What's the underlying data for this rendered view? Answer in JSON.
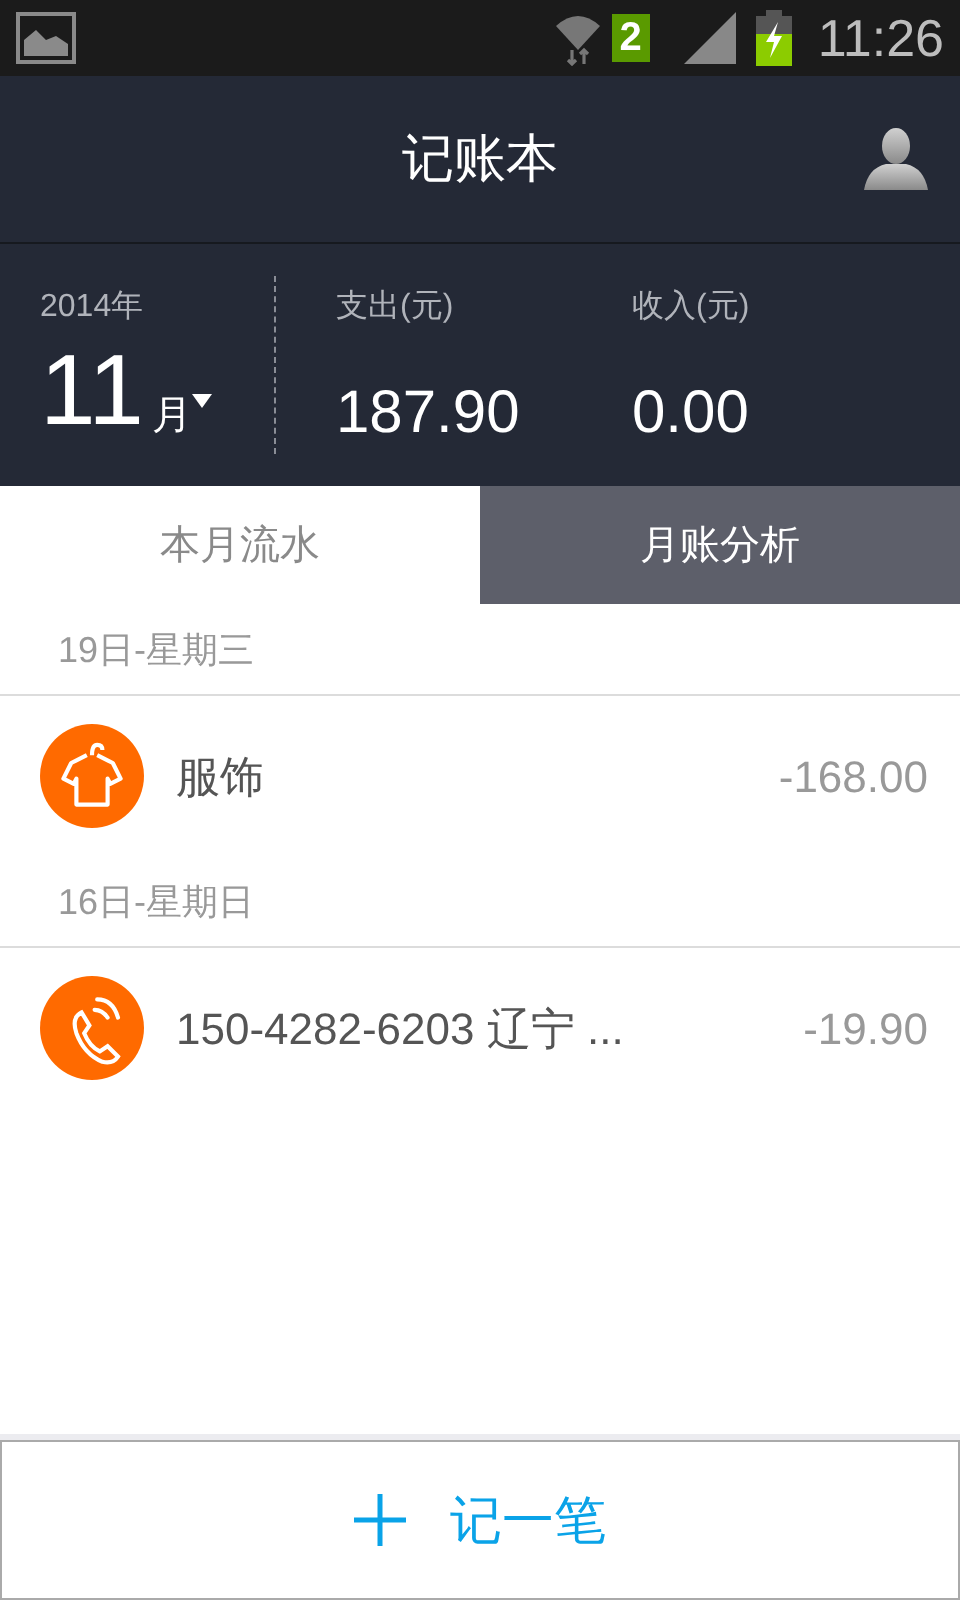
{
  "status_bar": {
    "sim_badge": "2",
    "time": "11:26"
  },
  "header": {
    "title": "记账本"
  },
  "summary": {
    "year": "2014年",
    "month": "11",
    "month_unit": "月",
    "expense_label": "支出(元)",
    "expense": "187.90",
    "income_label": "收入(元)",
    "income": "0.00"
  },
  "tabs": [
    {
      "label": "本月流水",
      "selected": true
    },
    {
      "label": "月账分析",
      "selected": false
    }
  ],
  "groups": [
    {
      "date": "19日-星期三",
      "entries": [
        {
          "kind": "clothing",
          "name": "服饰",
          "amount": "-168.00"
        }
      ]
    },
    {
      "date": "16日-星期日",
      "entries": [
        {
          "kind": "phone",
          "name": "150-4282-6203 辽宁 ...",
          "amount": "-19.90"
        }
      ]
    }
  ],
  "add_button": {
    "label": "记一笔"
  }
}
